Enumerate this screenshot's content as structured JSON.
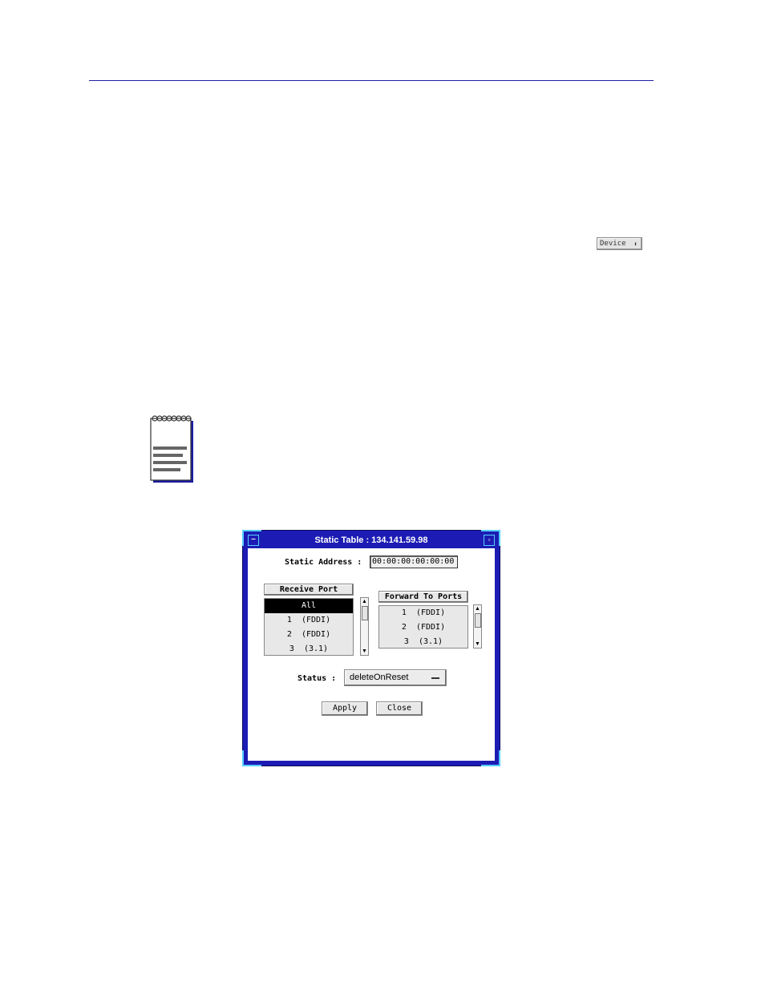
{
  "page": {
    "inline_button": {
      "label": "Device",
      "icon": "up-down-arrow-icon"
    }
  },
  "dialog": {
    "title": "Static Table : 134.141.59.98",
    "static_address_label": "Static Address :",
    "static_address_value": "00:00:00:00:00:00",
    "receive_port": {
      "header": "Receive Port",
      "items": [
        "All",
        "1  (FDDI)",
        "2  (FDDI)",
        "3  (3.1)"
      ],
      "selected_index": 0
    },
    "forward_ports": {
      "header": "Forward To Ports",
      "items": [
        "1  (FDDI)",
        "2  (FDDI)",
        "3  (3.1)"
      ]
    },
    "status_label": "Status :",
    "status_value": "deleteOnReset",
    "apply_label": "Apply",
    "close_label": "Close"
  },
  "colors": {
    "title_bar": "#1c1cb4",
    "frame_accent": "#55d0ff",
    "rule": "#2020a8"
  }
}
